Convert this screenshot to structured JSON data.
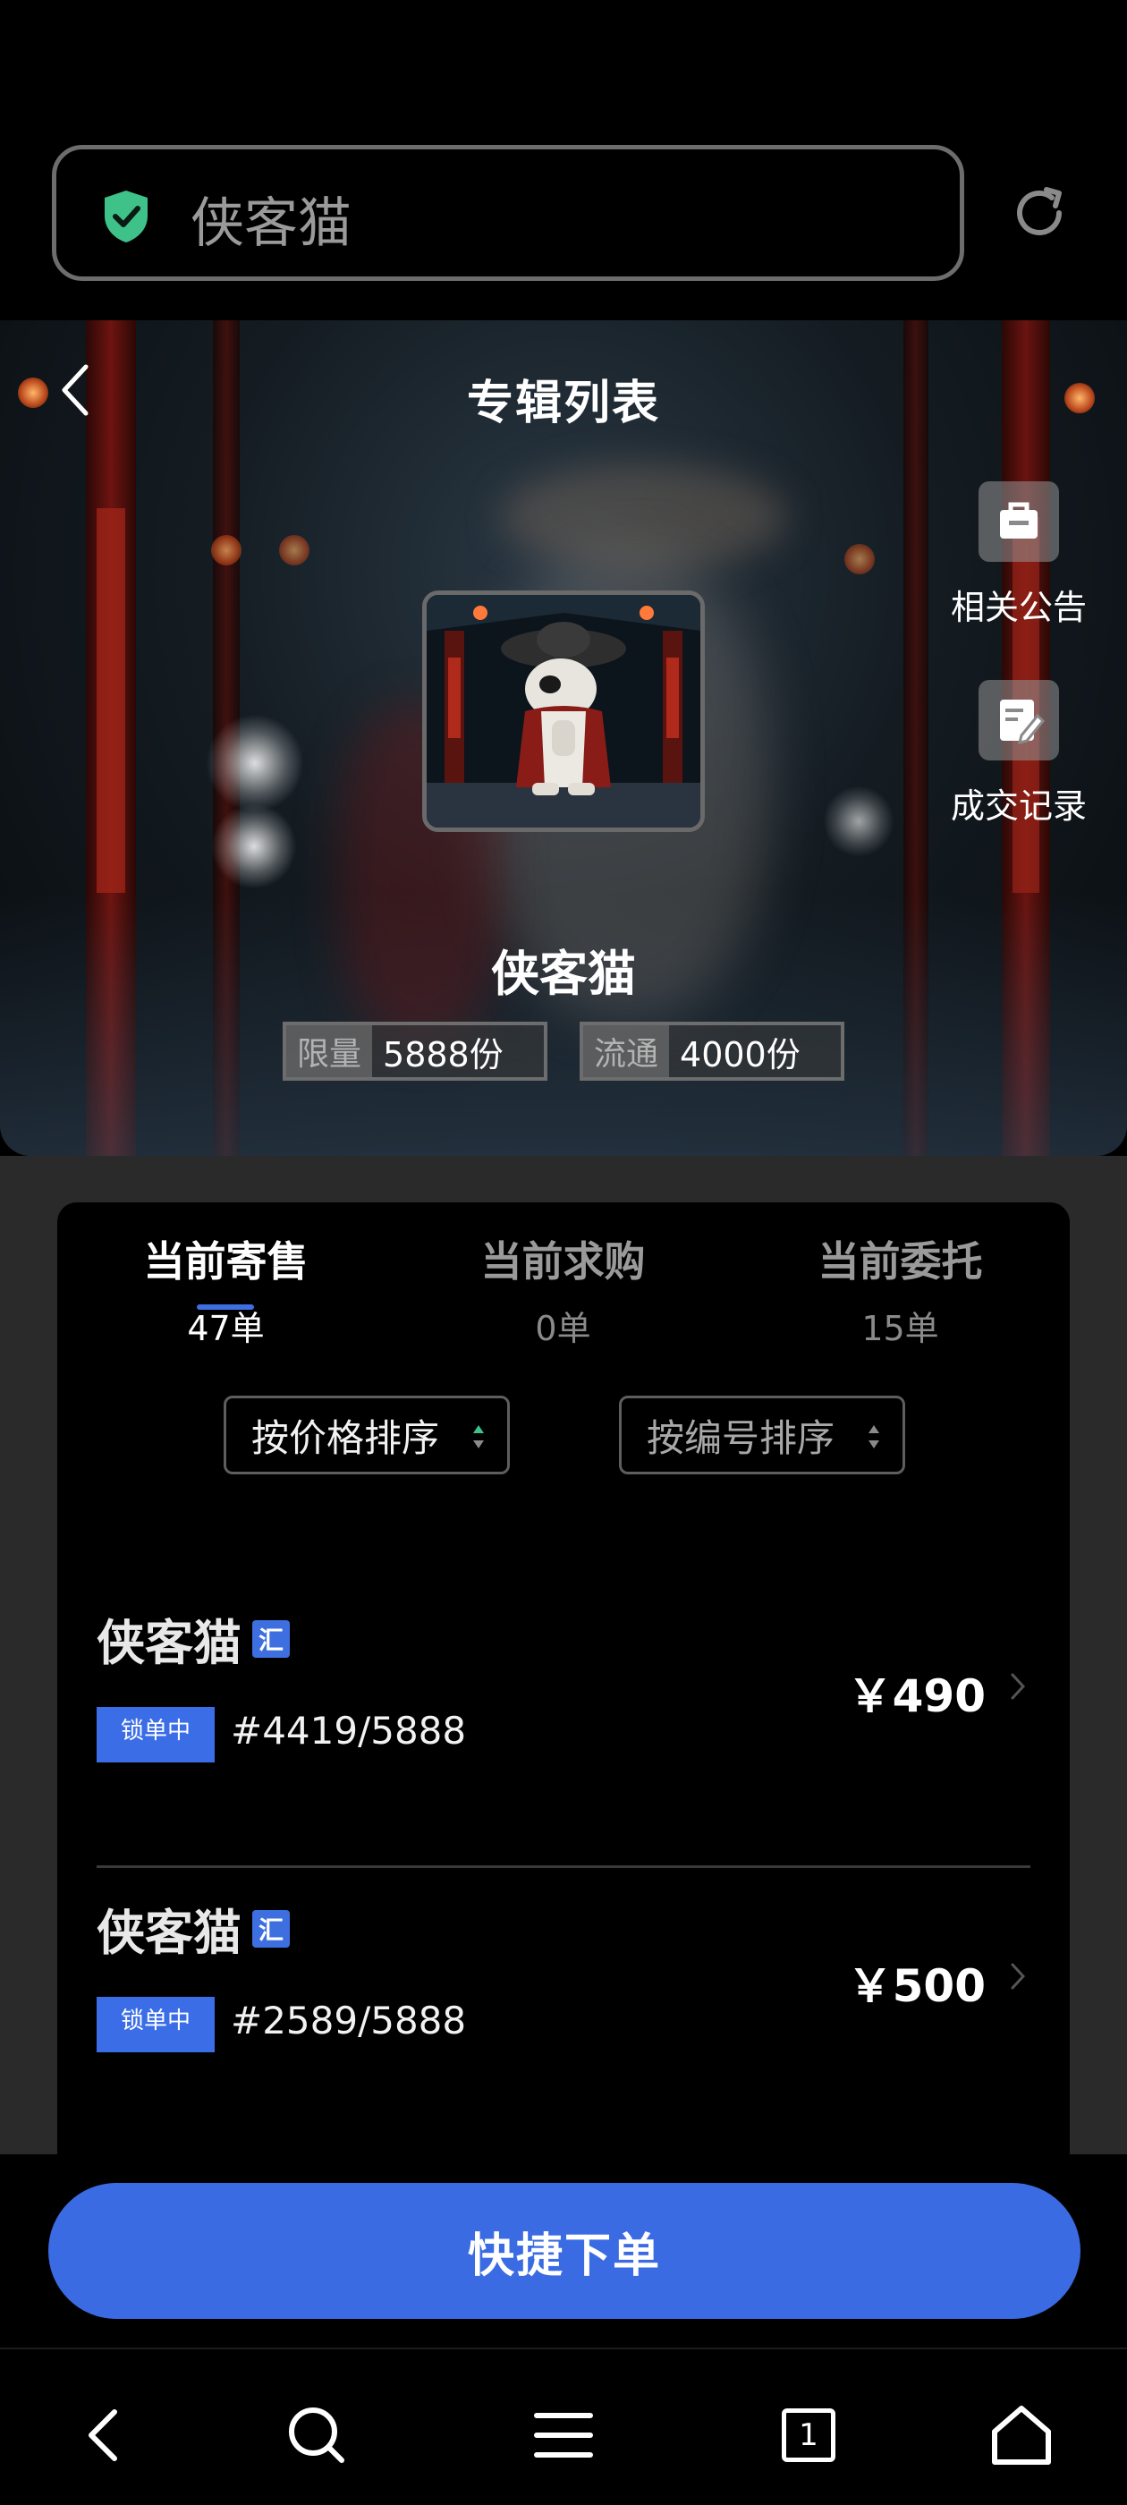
{
  "browser": {
    "url_text": "侠客猫",
    "icons": {
      "secure": "shield-check-icon",
      "reload": "refresh-icon"
    }
  },
  "hero": {
    "title": "专辑列表",
    "actions": [
      {
        "label": "相关公告",
        "icon": "announcement-bag-icon"
      },
      {
        "label": "成交记录",
        "icon": "record-edit-icon"
      }
    ],
    "item_name": "侠客猫",
    "stats": [
      {
        "label": "限量",
        "value": "5888份"
      },
      {
        "label": "流通",
        "value": "4000份"
      }
    ]
  },
  "tabs": [
    {
      "label": "当前寄售",
      "count": "47单",
      "active": true
    },
    {
      "label": "当前求购",
      "count": "0单",
      "active": false
    },
    {
      "label": "当前委托",
      "count": "15单",
      "active": false
    }
  ],
  "sort": {
    "by_price": "按价格排序",
    "by_number": "按编号排序"
  },
  "listings": [
    {
      "name": "侠客猫",
      "badge": "汇",
      "status": "锁单中",
      "serial": "#4419/5888",
      "price": "￥490"
    },
    {
      "name": "侠客猫",
      "badge": "汇",
      "status": "锁单中",
      "serial": "#2589/5888",
      "price": "￥500"
    }
  ],
  "cta": {
    "label": "快捷下单"
  },
  "sysnav": {
    "tab_count": "1"
  },
  "colors": {
    "accent": "#3b6be3",
    "secure_green": "#3fc28a",
    "background": "#000000"
  }
}
